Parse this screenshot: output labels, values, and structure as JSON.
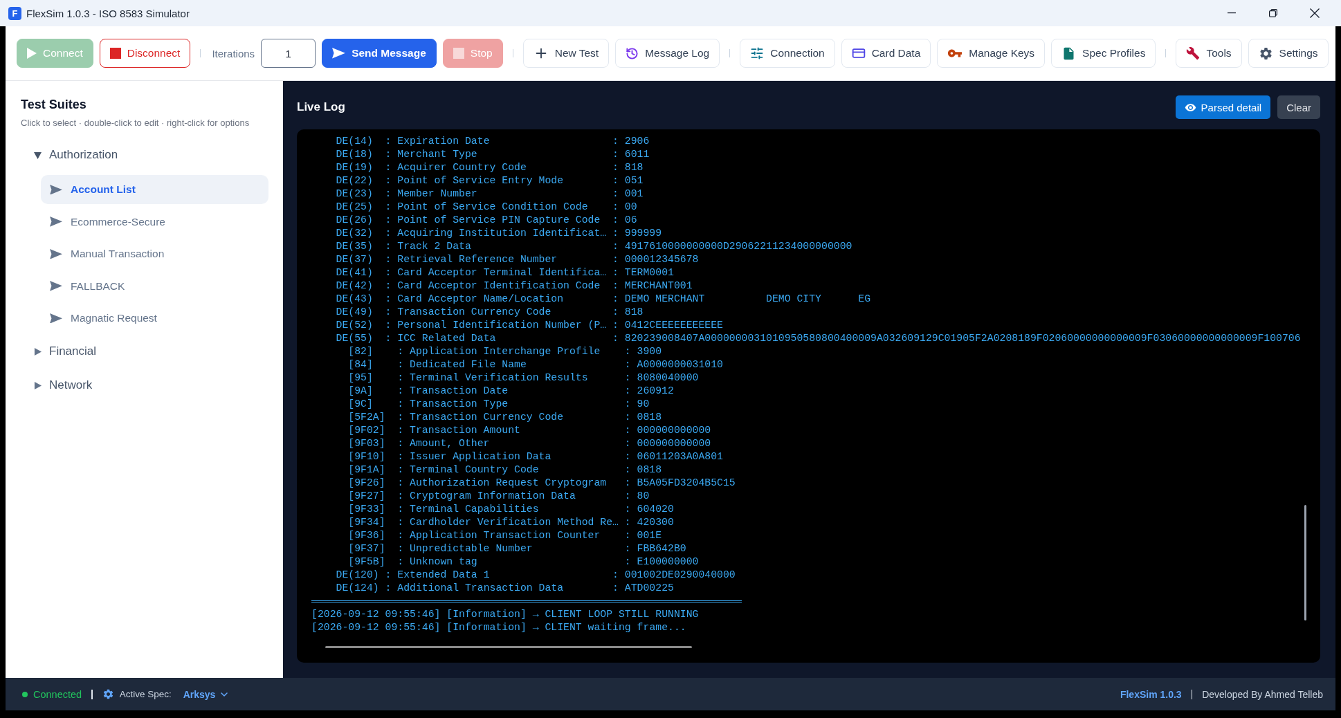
{
  "window": {
    "icon_letter": "F",
    "title": "FlexSim 1.0.3 - ISO 8583 Simulator"
  },
  "toolbar": {
    "items": [
      {
        "kind": "button",
        "label": "Connect",
        "disabled": true
      },
      {
        "kind": "button",
        "label": "Disconnect",
        "disabled": false
      },
      {
        "kind": "separator"
      },
      {
        "kind": "field",
        "label": "Iterations",
        "value": "1"
      },
      {
        "kind": "button",
        "label": "Send Message",
        "disabled": false
      },
      {
        "kind": "button",
        "label": "Stop",
        "disabled": true
      },
      {
        "kind": "separator"
      },
      {
        "kind": "button",
        "label": "New Test",
        "disabled": false
      },
      {
        "kind": "button",
        "label": "Message Log",
        "disabled": false
      },
      {
        "kind": "separator"
      },
      {
        "kind": "button",
        "label": "Connection",
        "disabled": false
      },
      {
        "kind": "button",
        "label": "Card Data",
        "disabled": false
      },
      {
        "kind": "button",
        "label": "Manage Keys",
        "disabled": false
      },
      {
        "kind": "button",
        "label": "Spec Profiles",
        "disabled": false
      },
      {
        "kind": "separator"
      },
      {
        "kind": "button",
        "label": "Tools",
        "disabled": false
      },
      {
        "kind": "button",
        "label": "Settings",
        "disabled": false
      }
    ]
  },
  "sidebar": {
    "title": "Test Suites",
    "hint": "Click to select · double-click to edit · right-click for options",
    "tree": [
      {
        "label": "Authorization",
        "expanded": true,
        "children": [
          {
            "label": "Account List",
            "selected": true
          },
          {
            "label": "Ecommerce-Secure",
            "selected": false
          },
          {
            "label": "Manual Transaction",
            "selected": false
          },
          {
            "label": "FALLBACK",
            "selected": false
          },
          {
            "label": "Magnatic Request",
            "selected": false
          }
        ]
      },
      {
        "label": "Financial",
        "expanded": false
      },
      {
        "label": "Network",
        "expanded": false
      }
    ]
  },
  "live_log": {
    "title": "Live Log",
    "buttons": [
      {
        "label": "Parsed detail"
      },
      {
        "label": "Clear"
      }
    ],
    "lines": [
      {
        "kind": "field",
        "text": "DE(14)  : Expiration Date                    : 2906"
      },
      {
        "kind": "field",
        "text": "DE(18)  : Merchant Type                      : 6011"
      },
      {
        "kind": "field",
        "text": "DE(19)  : Acquirer Country Code              : 818"
      },
      {
        "kind": "field",
        "text": "DE(22)  : Point of Service Entry Mode        : 051"
      },
      {
        "kind": "field",
        "text": "DE(23)  : Member Number                      : 001"
      },
      {
        "kind": "field",
        "text": "DE(25)  : Point of Service Condition Code    : 00"
      },
      {
        "kind": "field",
        "text": "DE(26)  : Point of Service PIN Capture Code  : 06"
      },
      {
        "kind": "field",
        "text": "DE(32)  : Acquiring Institution Identificat… : 999999"
      },
      {
        "kind": "field",
        "text": "DE(35)  : Track 2 Data                       : 4917610000000000D29062211234000000000"
      },
      {
        "kind": "field",
        "text": "DE(37)  : Retrieval Reference Number         : 000012345678"
      },
      {
        "kind": "field",
        "text": "DE(41)  : Card Acceptor Terminal Identifica… : TERM0001"
      },
      {
        "kind": "field",
        "text": "DE(42)  : Card Acceptor Identification Code  : MERCHANT001"
      },
      {
        "kind": "field",
        "text": "DE(43)  : Card Acceptor Name/Location        : DEMO MERCHANT          DEMO CITY      EG"
      },
      {
        "kind": "field",
        "text": "DE(49)  : Transaction Currency Code          : 818"
      },
      {
        "kind": "field",
        "text": "DE(52)  : Personal Identification Number (P… : 0412CEEEEEEEEEEE"
      },
      {
        "kind": "field",
        "text": "DE(55)  : ICC Related Data                   : 820239008407A0000000031010950580800400009A032609129C01905F2A0208189F02060000000000009F03060000000000009F100706"
      },
      {
        "kind": "tag",
        "text": "[82]    : Application Interchange Profile    : 3900"
      },
      {
        "kind": "tag",
        "text": "[84]    : Dedicated File Name                : A0000000031010"
      },
      {
        "kind": "tag",
        "text": "[95]    : Terminal Verification Results      : 8080040000"
      },
      {
        "kind": "tag",
        "text": "[9A]    : Transaction Date                   : 260912"
      },
      {
        "kind": "tag",
        "text": "[9C]    : Transaction Type                   : 90"
      },
      {
        "kind": "tag",
        "text": "[5F2A]  : Transaction Currency Code          : 0818"
      },
      {
        "kind": "tag",
        "text": "[9F02]  : Transaction Amount                 : 000000000000"
      },
      {
        "kind": "tag",
        "text": "[9F03]  : Amount, Other                      : 000000000000"
      },
      {
        "kind": "tag",
        "text": "[9F10]  : Issuer Application Data            : 06011203A0A801"
      },
      {
        "kind": "tag",
        "text": "[9F1A]  : Terminal Country Code              : 0818"
      },
      {
        "kind": "tag",
        "text": "[9F26]  : Authorization Request Cryptogram   : B5A05FD3204B5C15"
      },
      {
        "kind": "tag",
        "text": "[9F27]  : Cryptogram Information Data        : 80"
      },
      {
        "kind": "tag",
        "text": "[9F33]  : Terminal Capabilities              : 604020"
      },
      {
        "kind": "tag",
        "text": "[9F34]  : Cardholder Verification Method Re… : 420300"
      },
      {
        "kind": "tag",
        "text": "[9F36]  : Application Transaction Counter    : 001E"
      },
      {
        "kind": "tag",
        "text": "[9F37]  : Unpredictable Number               : FBB642B0"
      },
      {
        "kind": "tag",
        "text": "[9F5B]  : Unknown tag                        : E100000000"
      },
      {
        "kind": "field",
        "text": "DE(120) : Extended Data 1                    : 001002DE0290040000"
      },
      {
        "kind": "field",
        "text": "DE(124) : Additional Transaction Data        : ATD00225"
      },
      {
        "kind": "rule"
      },
      {
        "kind": "event",
        "text": "[2026-09-12 09:55:46] [Information] → CLIENT LOOP STILL RUNNING"
      },
      {
        "kind": "event",
        "text": "[2026-09-12 09:55:46] [Information] → CLIENT waiting frame..."
      }
    ]
  },
  "status_bar": {
    "connection": {
      "label": "Connected",
      "connected": true
    },
    "spec_label": "Active Spec:",
    "spec_value": "Arksys",
    "app_version": "FlexSim 1.0.3",
    "credit": "Developed By Ahmed Telleb"
  }
}
